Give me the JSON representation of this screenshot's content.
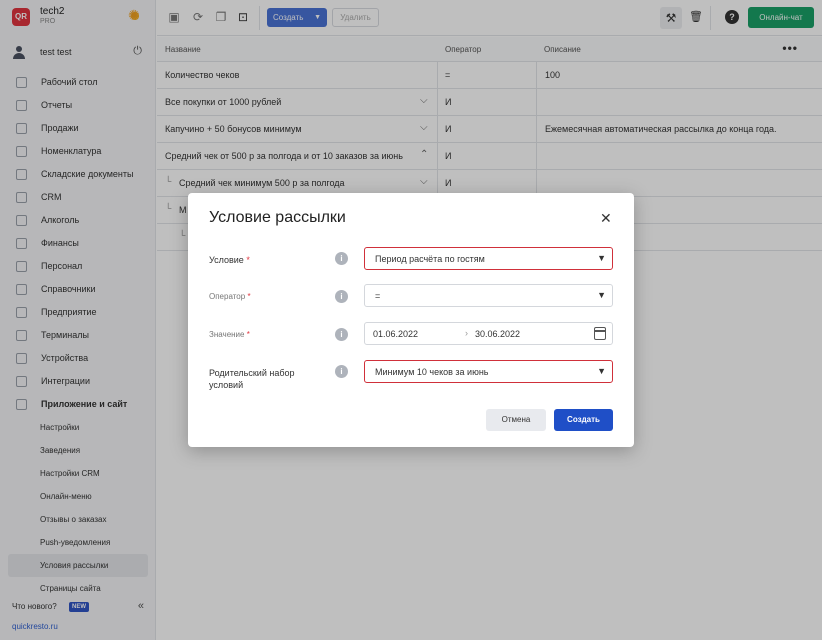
{
  "brand": {
    "name": "tech2",
    "plan": "PRO",
    "logo_text": "QR",
    "theme_icon": "sun-icon"
  },
  "user": {
    "name": "test test",
    "power_icon": "power-icon"
  },
  "sidebar": {
    "items": [
      {
        "label": "Рабочий стол",
        "icon": "dashboard-icon"
      },
      {
        "label": "Отчеты",
        "icon": "reports-icon"
      },
      {
        "label": "Продажи",
        "icon": "sales-icon"
      },
      {
        "label": "Номенклатура",
        "icon": "nomenclature-icon"
      },
      {
        "label": "Складские документы",
        "icon": "warehouse-icon"
      },
      {
        "label": "CRM",
        "icon": "crm-icon"
      },
      {
        "label": "Алкоголь",
        "icon": "alcohol-icon"
      },
      {
        "label": "Финансы",
        "icon": "finance-icon"
      },
      {
        "label": "Персонал",
        "icon": "staff-icon"
      },
      {
        "label": "Справочники",
        "icon": "directory-icon"
      },
      {
        "label": "Предприятие",
        "icon": "enterprise-icon"
      },
      {
        "label": "Терминалы",
        "icon": "terminal-icon"
      },
      {
        "label": "Устройства",
        "icon": "devices-icon"
      },
      {
        "label": "Интеграции",
        "icon": "integrations-icon"
      },
      {
        "label": "Приложение и сайт",
        "icon": "app-icon"
      }
    ],
    "subitems": [
      {
        "label": "Настройки"
      },
      {
        "label": "Заведения"
      },
      {
        "label": "Настройки CRM"
      },
      {
        "label": "Онлайн-меню"
      },
      {
        "label": "Отзывы о заказах"
      },
      {
        "label": "Push-уведомления"
      },
      {
        "label": "Условия рассылки"
      },
      {
        "label": "Страницы сайта"
      }
    ],
    "whats_new": "Что нового?",
    "new_badge": "NEW",
    "site_link": "quickresto.ru"
  },
  "toolbar": {
    "create_label": "Создать",
    "delete_label": "Удалить",
    "chat_label": "Онлайн-чат"
  },
  "table": {
    "headers": {
      "name": "Название",
      "operator": "Оператор",
      "description": "Описание"
    },
    "rows": [
      {
        "name": "Количество чеков",
        "operator": "=",
        "description": "100"
      },
      {
        "name": "Все покупки от 1000 рублей",
        "operator": "И",
        "description": ""
      },
      {
        "name": "Капучино + 50 бонусов минимум",
        "operator": "И",
        "description": "Ежемесячная автоматическая рассылка до конца года."
      },
      {
        "name": "Средний чек от 500 р за полгода и от 10 заказов за июнь",
        "operator": "И",
        "description": ""
      },
      {
        "name": "Средний чек минимум 500 р за полгода",
        "operator": "И",
        "description": ""
      },
      {
        "name": "М",
        "operator": "",
        "description": ""
      }
    ]
  },
  "modal": {
    "title": "Условие рассылки",
    "fields": {
      "condition": {
        "label": "Условие",
        "value": "Период расчёта по гостям"
      },
      "operator": {
        "label": "Оператор",
        "value": "="
      },
      "value": {
        "label": "Значение",
        "from": "01.06.2022",
        "to": "30.06.2022"
      },
      "parent": {
        "label": "Родительский набор условий",
        "value": "Минимум 10 чеков за июнь"
      }
    },
    "required_mark": "*",
    "cancel_label": "Отмена",
    "create_label": "Создать"
  },
  "colors": {
    "accent": "#1f4fc7",
    "error": "#d0303a",
    "chat": "#1aa067",
    "logo": "#e0353f"
  }
}
